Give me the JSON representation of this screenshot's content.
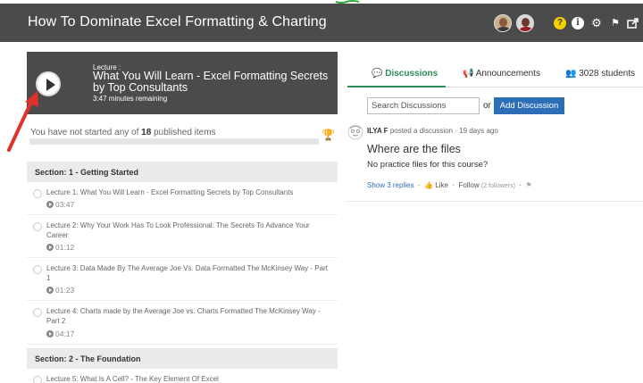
{
  "header": {
    "title": "How To Dominate Excel Formatting & Charting",
    "icons": [
      "avatar-1",
      "avatar-2",
      "help-icon",
      "info-icon",
      "gear-icon",
      "flag-icon",
      "share-icon"
    ]
  },
  "lecture": {
    "label": "Lecture :",
    "title": "What You Will Learn - Excel Formatting Secrets by Top Consultants",
    "remaining": "3:47 minutes remaining"
  },
  "progress": {
    "text_before": "You have not started any of",
    "count": "18",
    "text_after": "published items",
    "fraction": 0
  },
  "curriculum": {
    "sections": [
      {
        "title": "Section: 1 - Getting Started",
        "lectures": [
          {
            "title": "Lecture 1: What You Will Learn - Excel Formatting Secrets by Top Consultants",
            "duration": "03:47"
          },
          {
            "title": "Lecture 2: Why Your Work Has To Look Professional: The Secrets To Advance Your Career",
            "duration": "01:12"
          },
          {
            "title": "Lecture 3: Data Made By The Average Joe Vs. Data Formatted The McKinsey Way - Part 1",
            "duration": "01:23"
          },
          {
            "title": "Lecture 4: Charts made by the Average Joe vs. Charts Formatted The McKinsey Way - Part 2",
            "duration": "04:17"
          }
        ]
      },
      {
        "title": "Section: 2 - The Foundation",
        "lectures": [
          {
            "title": "Lecture 5: What Is A Cell? - The Key Element Of Excel",
            "duration": ""
          }
        ]
      }
    ]
  },
  "tabs": {
    "discussions": "Discussions",
    "announcements": "Announcements",
    "students": "3028 students"
  },
  "search": {
    "placeholder": "Search Discussions",
    "or": "or",
    "add_label": "Add Discussion"
  },
  "discussion": {
    "author": "ILYA F",
    "action": "posted a discussion",
    "time": "· 19 days ago",
    "title": "Where are the files",
    "body": "No practice files for this course?",
    "replies": "Show 3 replies",
    "like": "Like",
    "follow": "Follow",
    "followers": "(2 followers)"
  },
  "colors": {
    "header_bg": "#4b4b4b",
    "accent_green": "#2e8b57",
    "button_blue": "#2d6fb7",
    "arrow_red": "#e0322b"
  }
}
